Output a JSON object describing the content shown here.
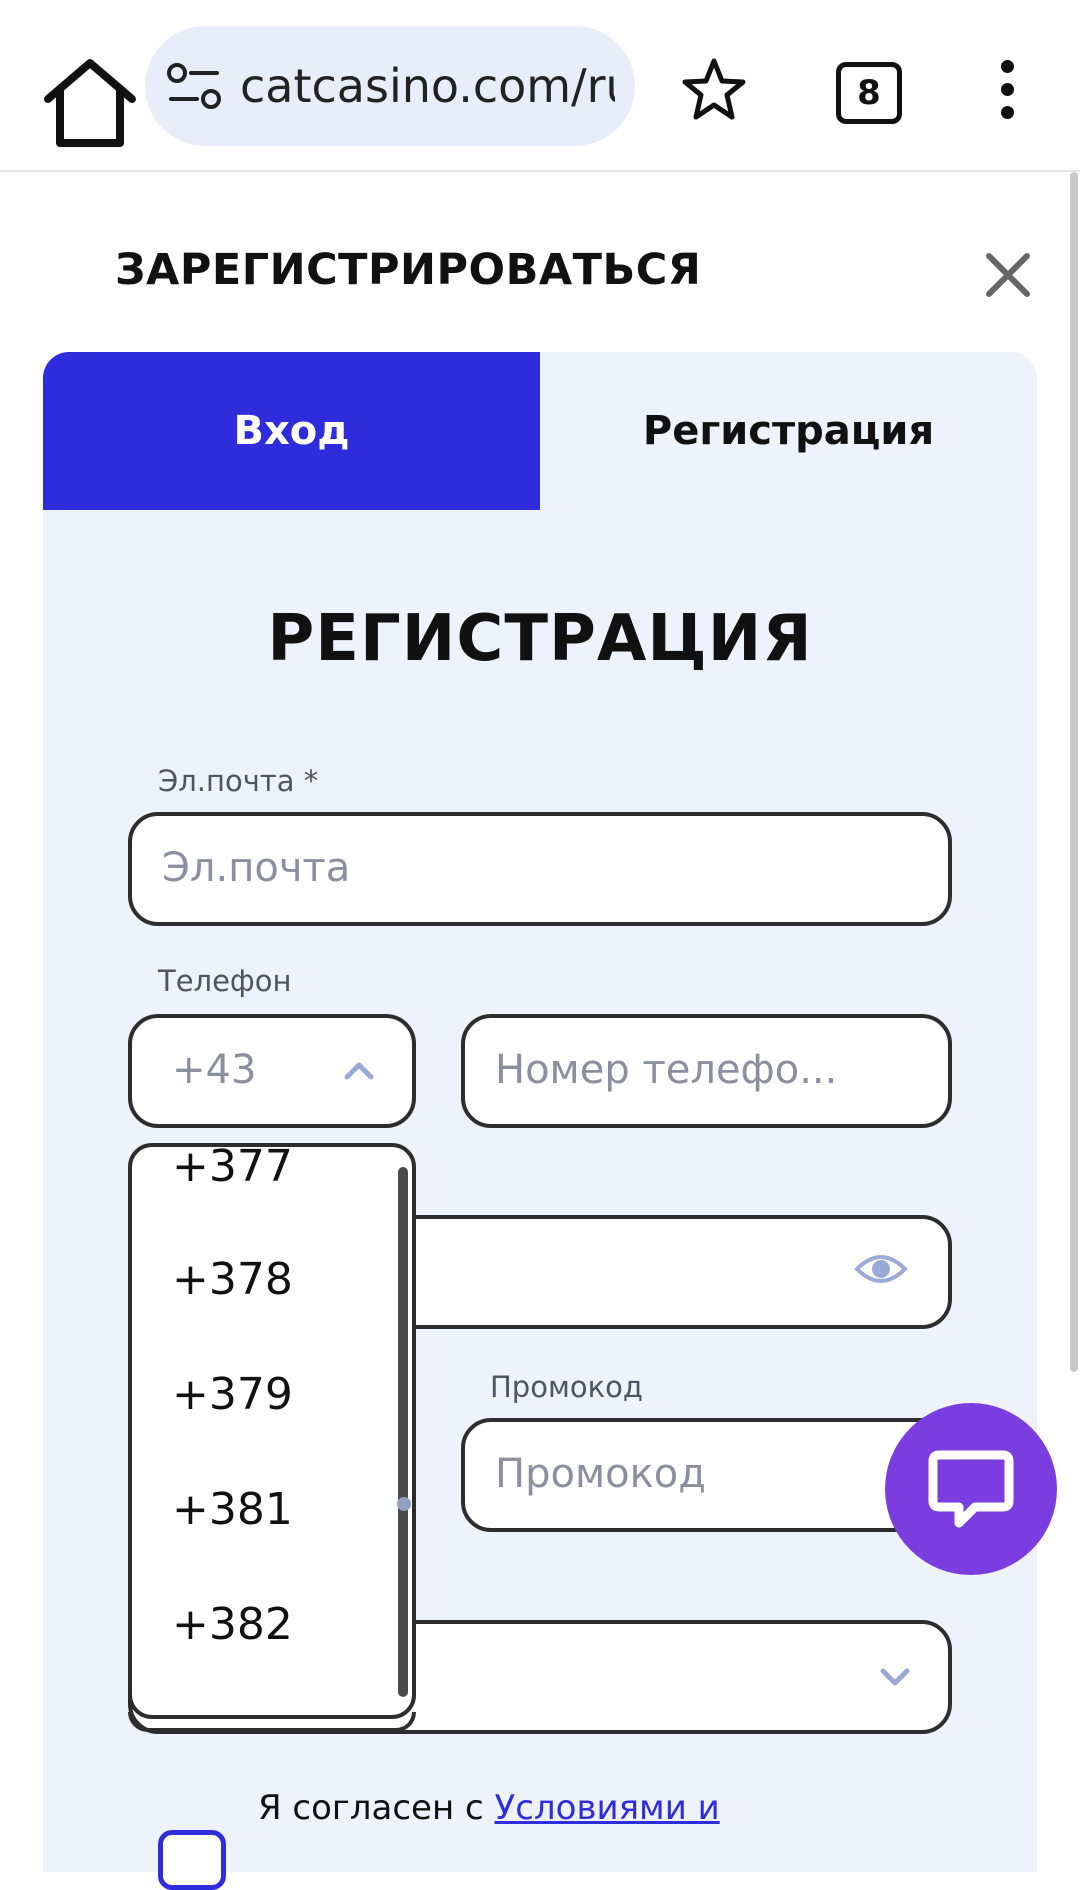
{
  "browser": {
    "url": "catcasino.com/ru",
    "tab_count": "8"
  },
  "modal": {
    "title": "ЗАРЕГИСТРИРОВАТЬСЯ",
    "tabs": {
      "login": "Вход",
      "register": "Регистрация"
    },
    "active_tab": "login"
  },
  "form": {
    "heading": "РЕГИСТРАЦИЯ",
    "email_label": "Эл.почта *",
    "email_placeholder": "Эл.почта",
    "phone_label": "Телефон",
    "phone_code_value": "+43",
    "phone_placeholder": "Номер телефо...",
    "promo_label": "Промокод",
    "promo_placeholder": "Промокод",
    "agree_text": "Я согласен с ",
    "agree_link": "Условиями и"
  },
  "phone_code_dropdown": {
    "options": [
      "+377",
      "+378",
      "+379",
      "+381",
      "+382"
    ]
  },
  "colors": {
    "accent": "#2f2cdc",
    "panel_bg": "#eef2fb",
    "chat_button": "#7b3de0"
  }
}
